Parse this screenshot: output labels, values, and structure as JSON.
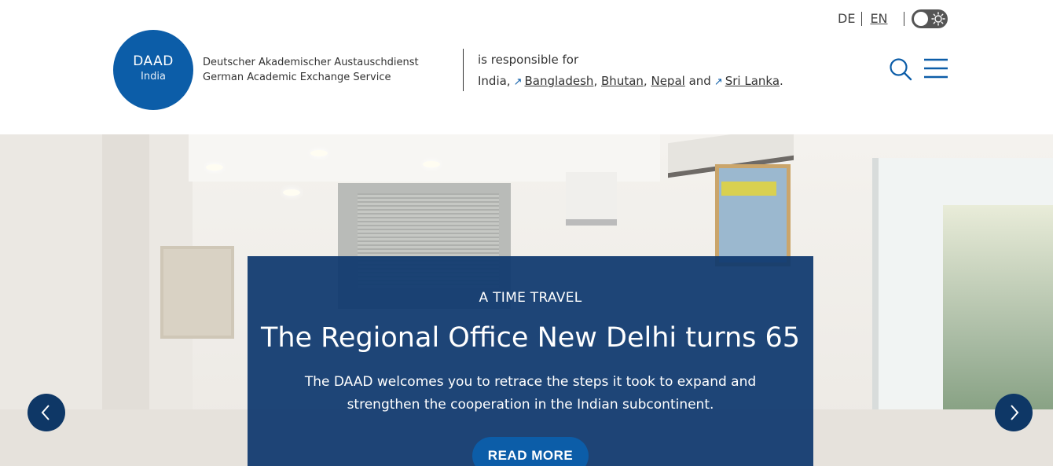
{
  "language": {
    "de_label": "DE",
    "en_label": "EN"
  },
  "theme_toggle": {
    "icon": "sun-icon"
  },
  "logo": {
    "title": "DAAD",
    "subtitle": "India"
  },
  "organization": {
    "name_de": "Deutscher Akademischer Austauschdienst",
    "name_en": "German Academic Exchange Service"
  },
  "responsibility": {
    "intro": "is responsible for",
    "home_country": "India,",
    "countries": [
      "Bangladesh",
      "Bhutan",
      "Nepal",
      "Sri Lanka"
    ],
    "separators": [
      ",",
      ","
    ],
    "and_word": "and",
    "end_period": "."
  },
  "header_icons": {
    "search": "search-icon",
    "menu": "hamburger-menu-icon"
  },
  "hero": {
    "kicker": "A TIME TRAVEL",
    "title": "The Regional Office New Delhi turns 65",
    "teaser": "The DAAD welcomes you to retrace the steps it took to expand and strengthen the cooperation in the Indian subcontinent.",
    "button_label": "READ MORE",
    "prev_icon": "chevron-left-icon",
    "next_icon": "chevron-right-icon"
  },
  "colors": {
    "brand_blue": "#0c5da8",
    "card_navy": "#0e386e",
    "arrow_navy": "#0e3766"
  }
}
